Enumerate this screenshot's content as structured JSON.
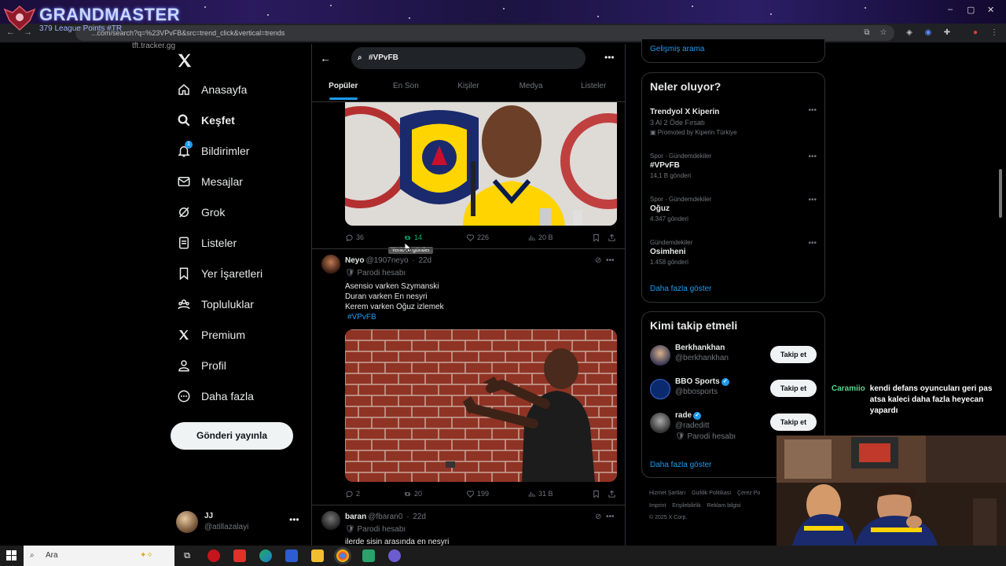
{
  "browser": {
    "url": "...com/search?q=%23VPvFB&src=trend_click&vertical=trends"
  },
  "overlay": {
    "title": "GRANDMASTER",
    "subtitle": "379 League Points #TR",
    "tracker": "tft.tracker.gg"
  },
  "nav": {
    "items": [
      {
        "label": "Anasayfa",
        "icon": "home-icon"
      },
      {
        "label": "Keşfet",
        "icon": "search-icon"
      },
      {
        "label": "Bildirimler",
        "icon": "bell-icon"
      },
      {
        "label": "Mesajlar",
        "icon": "mail-icon"
      },
      {
        "label": "Grok",
        "icon": "grok-icon"
      },
      {
        "label": "Listeler",
        "icon": "list-icon"
      },
      {
        "label": "Yer İşaretleri",
        "icon": "bookmark-icon"
      },
      {
        "label": "Topluluklar",
        "icon": "communities-icon"
      },
      {
        "label": "Premium",
        "icon": "x-logo-icon"
      },
      {
        "label": "Profil",
        "icon": "profile-icon"
      },
      {
        "label": "Daha fazla",
        "icon": "more-circle-icon"
      }
    ],
    "notification_badge": "1",
    "post_button": "Gönderi yayınla",
    "account": {
      "name": "JJ",
      "handle": "@atillazalayi"
    }
  },
  "search": {
    "query": "#VPvFB",
    "tabs": [
      "Popüler",
      "En Son",
      "Kişiler",
      "Medya",
      "Listeler"
    ]
  },
  "tweets": [
    {
      "stats": {
        "replies": "36",
        "retweets": "14",
        "likes": "226",
        "views": "20 B"
      },
      "tooltip": "Yeniden gönder"
    },
    {
      "name": "Neyo",
      "handle": "@1907neyo",
      "time": "22d",
      "badge": "Parodi hesabı",
      "lines": [
        "Asensio varken Szymanski",
        "Duran varken En nesyri",
        "Kerem varken Oğuz izlemek"
      ],
      "hashtag": "#VPvFB",
      "stats": {
        "replies": "2",
        "retweets": "20",
        "likes": "199",
        "views": "31 B"
      }
    },
    {
      "name": "baran",
      "handle": "@fbaran0",
      "time": "22d",
      "badge": "Parodi hesabı",
      "lines": [
        "ilerde sisin arasında en nesyri"
      ]
    }
  ],
  "right": {
    "advanced_search": "Gelişmiş arama",
    "trends_title": "Neler oluyor?",
    "trends": [
      {
        "category": "",
        "title": "Trendyol X Kiperin",
        "count": "3 Al 2 Öde Fırsatı",
        "promoted": "Promoted by Kiperin Türkiye"
      },
      {
        "category": "Spor · Gündemdekiler",
        "title": "#VPvFB",
        "count": "14,1 B gönderi"
      },
      {
        "category": "Spor · Gündemdekiler",
        "title": "Oğuz",
        "count": "4.347 gönderi"
      },
      {
        "category": "Gündemdekiler",
        "title": "Osimheni",
        "count": "1.458 gönderi"
      }
    ],
    "show_more": "Daha fazla göster",
    "who_to_follow_title": "Kimi takip etmeli",
    "follow": [
      {
        "name": "Berkhankhan",
        "handle": "@berkhankhan",
        "verified": false,
        "extra": ""
      },
      {
        "name": "BBO Sports",
        "handle": "@bbosports",
        "verified": true,
        "extra": ""
      },
      {
        "name": "rade",
        "handle": "@radeditt",
        "verified": true,
        "extra": "Parodi hesabı"
      }
    ],
    "follow_button": "Takip et",
    "footer": {
      "row1": [
        "Hizmet Şartları",
        "Gizlilik Politikası",
        "Çerez Po"
      ],
      "row2": [
        "Imprint",
        "Erişilebilirlik",
        "Reklam bilgisi"
      ],
      "copyright": "© 2025 X Corp."
    }
  },
  "chat": {
    "user": "Caramiio",
    "message": "kendi defans oyuncuları geri pas atsa kaleci daha fazla heyecan yapardı"
  },
  "taskbar": {
    "search_placeholder": "Ara"
  },
  "colors": {
    "accent": "#1d9bf0",
    "retweet_active": "#00ba7c",
    "background": "#000000",
    "border": "#2f3336",
    "muted_text": "#71767b"
  }
}
